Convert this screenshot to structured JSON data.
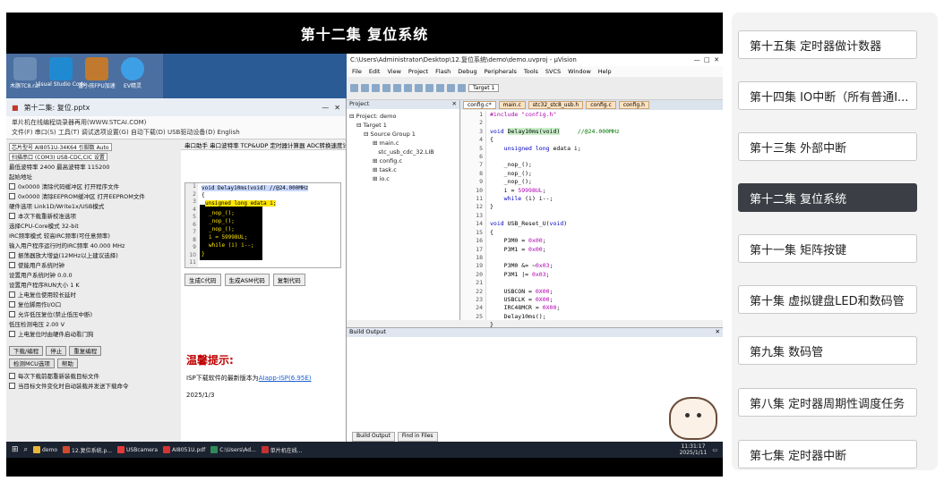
{
  "video": {
    "title": "第十二集 复位系统",
    "desktop_icons": [
      {
        "label": "木豚TC8.rar",
        "color": "#6b8cb5"
      },
      {
        "label": "Visual Studio Code",
        "color": "#1f8ad2"
      },
      {
        "label": "雷小孩FPU加速",
        "color": "#c0792e"
      },
      {
        "label": "EV精灵",
        "color": "#3da0e6"
      }
    ],
    "isp": {
      "window_title": "第十二集: 复位.pptx",
      "app_title": "单片机在线编程烧录器再用(WWW.STCAI.COM)",
      "menu": "文件(F)  串口(S)  工具(T)  调试选项设置(G)  自动下载(D)  USB驱动设备(D)  English",
      "left_rows": [
        "芯片型号  AI8051U-34K64   引脚数 Auto",
        "扫描串口  (COM3) USB-CDC,CIC   设置",
        "最低波特率 2400   最高波特率 115200",
        "起始地址",
        "0x0000  清除代码缓冲区   打开程序文件",
        "0x0000  清除EEPROM缓冲区  打开EEPROM文件",
        "硬件选项  Link1D/Write1x/USB模式",
        "本次下载重新校准选项",
        "选择CPU-Core模式  32-bit",
        "IRC频率模式  较高IRC频率(可任意频率)",
        "输入用户程序运行时的IRC频率  40.000  MHz",
        "振荡器放大增益(12MHz以上建议选择)",
        "使能用户系统时钟",
        "设置用户系统时钟  0.0.0",
        "设置用户程序RUN大小  1  K",
        "上电复位使用较长延时",
        "复位脚用作I/O口",
        "允许低压复位(禁止低压中断)",
        "低压检测电压  2.00 V",
        "上电复位时由硬件启动看门狗"
      ],
      "download_btn": "下载/编程",
      "stop_btn": "停止",
      "reprogram_btn": "重复编程",
      "check_btn": "检测MCU选项",
      "help_btn": "帮助",
      "reload_opt": "每次下载前都重新装载目标文件",
      "auto_opt": "当目标文件变化时自动装载并发送下载命令",
      "tabs": "串口助手 串口波特率 TCP&UDP 定时器计算器  ADC转换速度计算器  定时器",
      "code_lines": [
        "void Delay10ms(void)  //@24.000MHz",
        "{",
        "unsigned long edata i;",
        "_nop_();",
        "_nop_();",
        "_nop_();",
        "i = 59998UL;",
        "while (i) i--;",
        "}"
      ],
      "code_buttons": [
        "生成C代码",
        "生成ASM代码",
        "复制代码"
      ],
      "notice_title": "温馨提示:",
      "notice_text": "ISP下载软件的最新版本为",
      "notice_link": "AIapp-ISP(6.95E)",
      "notice_date": "2025/1/3"
    },
    "uvision": {
      "title": "C:\\Users\\Administrator\\Desktop\\12.复位系统\\demo\\demo.uvproj - µVision",
      "menu": [
        "File",
        "Edit",
        "View",
        "Project",
        "Flash",
        "Debug",
        "Peripherals",
        "Tools",
        "SVCS",
        "Window",
        "Help"
      ],
      "target": "Target 1",
      "project_header": "Project",
      "tree": [
        "Project: demo",
        "Target 1",
        "Source Group 1",
        "main.c",
        "stc_usb_cdc_32.LIB",
        "config.c",
        "task.c",
        "io.c"
      ],
      "file_tabs": [
        "config.c*",
        "main.c",
        "stc32_stc8_usb.h",
        "config.c",
        "config.h"
      ],
      "line_numbers": [
        "1",
        "2",
        "3",
        "4",
        "5",
        "6",
        "7",
        "8",
        "9",
        "10",
        "11",
        "12",
        "13",
        "14",
        "15",
        "16",
        "17",
        "18",
        "19",
        "20",
        "21",
        "22",
        "23",
        "24",
        "25"
      ],
      "output_header": "Build Output",
      "output_tabs": [
        "Build Output",
        "Find in Files"
      ]
    },
    "taskbar": {
      "items": [
        {
          "label": "demo",
          "color": "#e8b73a"
        },
        {
          "label": "12.复位系统.p...",
          "color": "#d24a2c"
        },
        {
          "label": "USBcamera",
          "color": "#e23b3b"
        },
        {
          "label": "AI8051U.pdf",
          "color": "#d63333"
        },
        {
          "label": "C:\\Users\\Ad...",
          "color": "#2e8b57"
        },
        {
          "label": "单片机在线...",
          "color": "#c23232"
        }
      ],
      "time": "11:31:17",
      "date": "2025/1/11"
    }
  },
  "playlist": [
    {
      "label": "第十五集 定时器做计数器",
      "active": false
    },
    {
      "label": "第十四集 IO中断（所有普通I...",
      "active": false
    },
    {
      "label": "第十三集 外部中断",
      "active": false
    },
    {
      "label": "第十二集 复位系统",
      "active": true
    },
    {
      "label": "第十一集 矩阵按键",
      "active": false
    },
    {
      "label": "第十集 虚拟键盘LED和数码管",
      "active": false
    },
    {
      "label": "第九集 数码管",
      "active": false
    },
    {
      "label": "第八集 定时器周期性调度任务",
      "active": false
    },
    {
      "label": "第七集 定时器中断",
      "active": false
    }
  ]
}
